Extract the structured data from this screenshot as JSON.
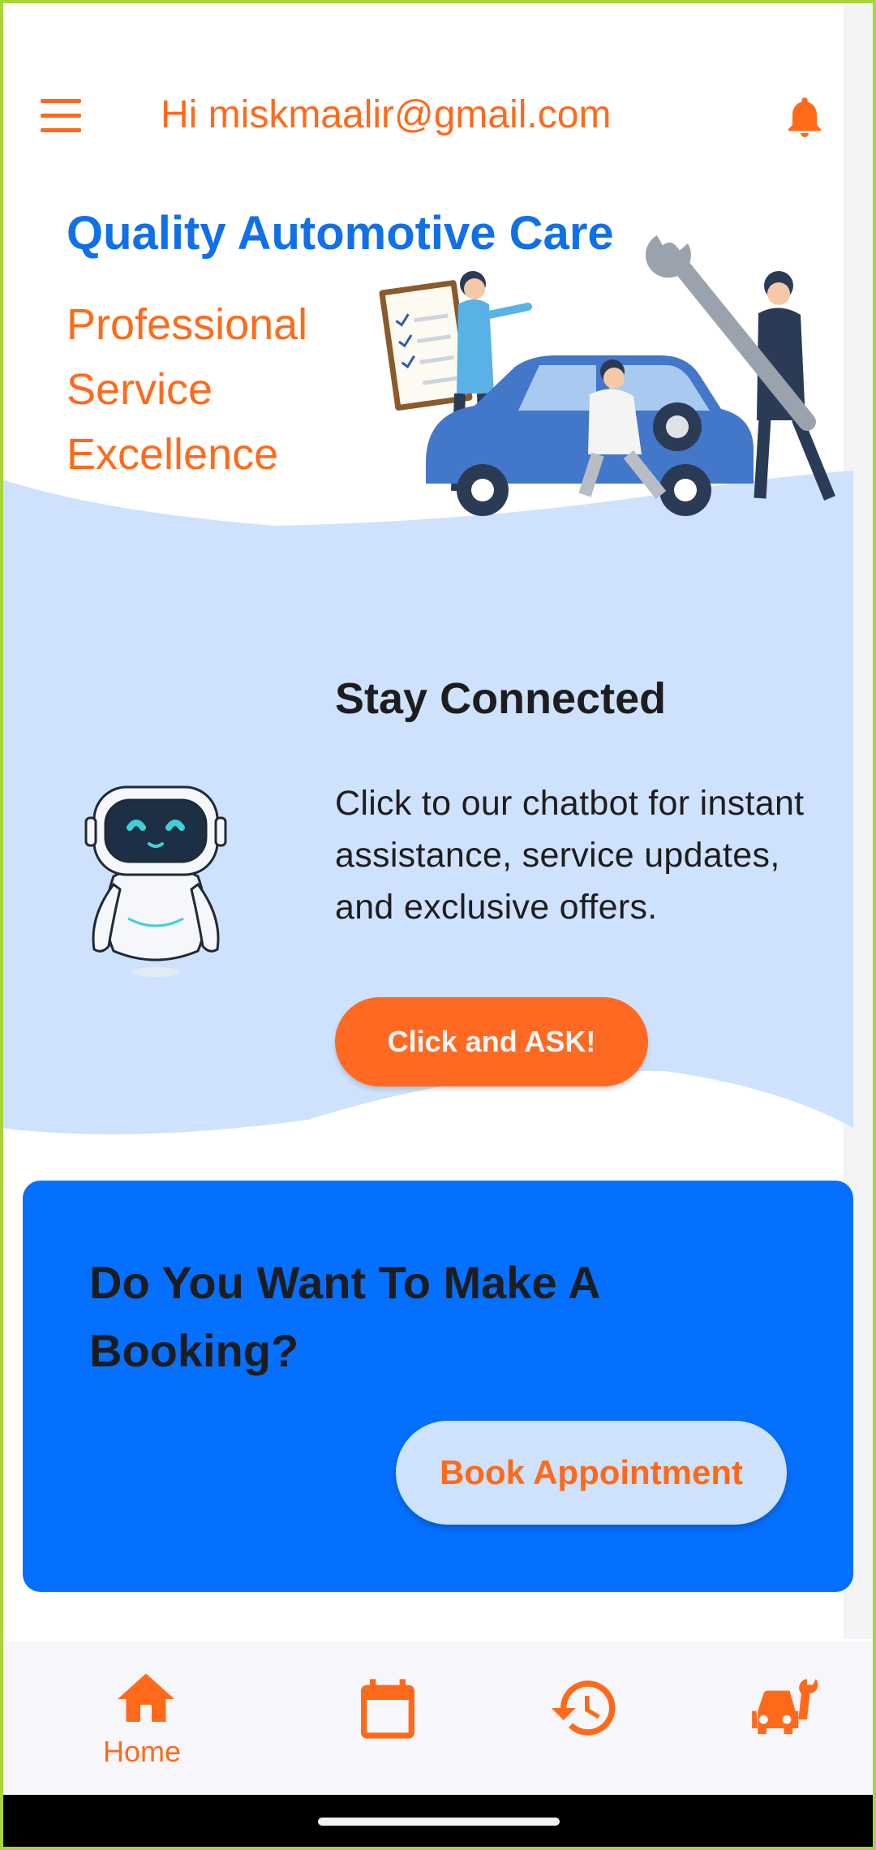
{
  "header": {
    "greeting": "Hi miskmaalir@gmail.com",
    "menu_icon": "hamburger-menu-icon",
    "notification_icon": "bell-icon"
  },
  "hero": {
    "title": "Quality Automotive Care",
    "subtitle": "Professional Service Excellence"
  },
  "chat": {
    "title": "Stay Connected",
    "description": "Click to our chatbot for instant assistance, service updates, and exclusive offers.",
    "button": "Click and ASK!"
  },
  "booking": {
    "title": "Do You Want To Make A Booking?",
    "button": "Book Appointment"
  },
  "nav": {
    "items": [
      {
        "label": "Home",
        "icon": "home-icon",
        "active": true
      },
      {
        "label": "",
        "icon": "calendar-icon"
      },
      {
        "label": "",
        "icon": "history-icon"
      },
      {
        "label": "",
        "icon": "car-service-icon"
      }
    ]
  },
  "colors": {
    "accent_orange": "#ff6a1a",
    "brand_blue": "#1170e8",
    "card_blue": "#0570fd",
    "light_blue": "#cfe2fd"
  }
}
